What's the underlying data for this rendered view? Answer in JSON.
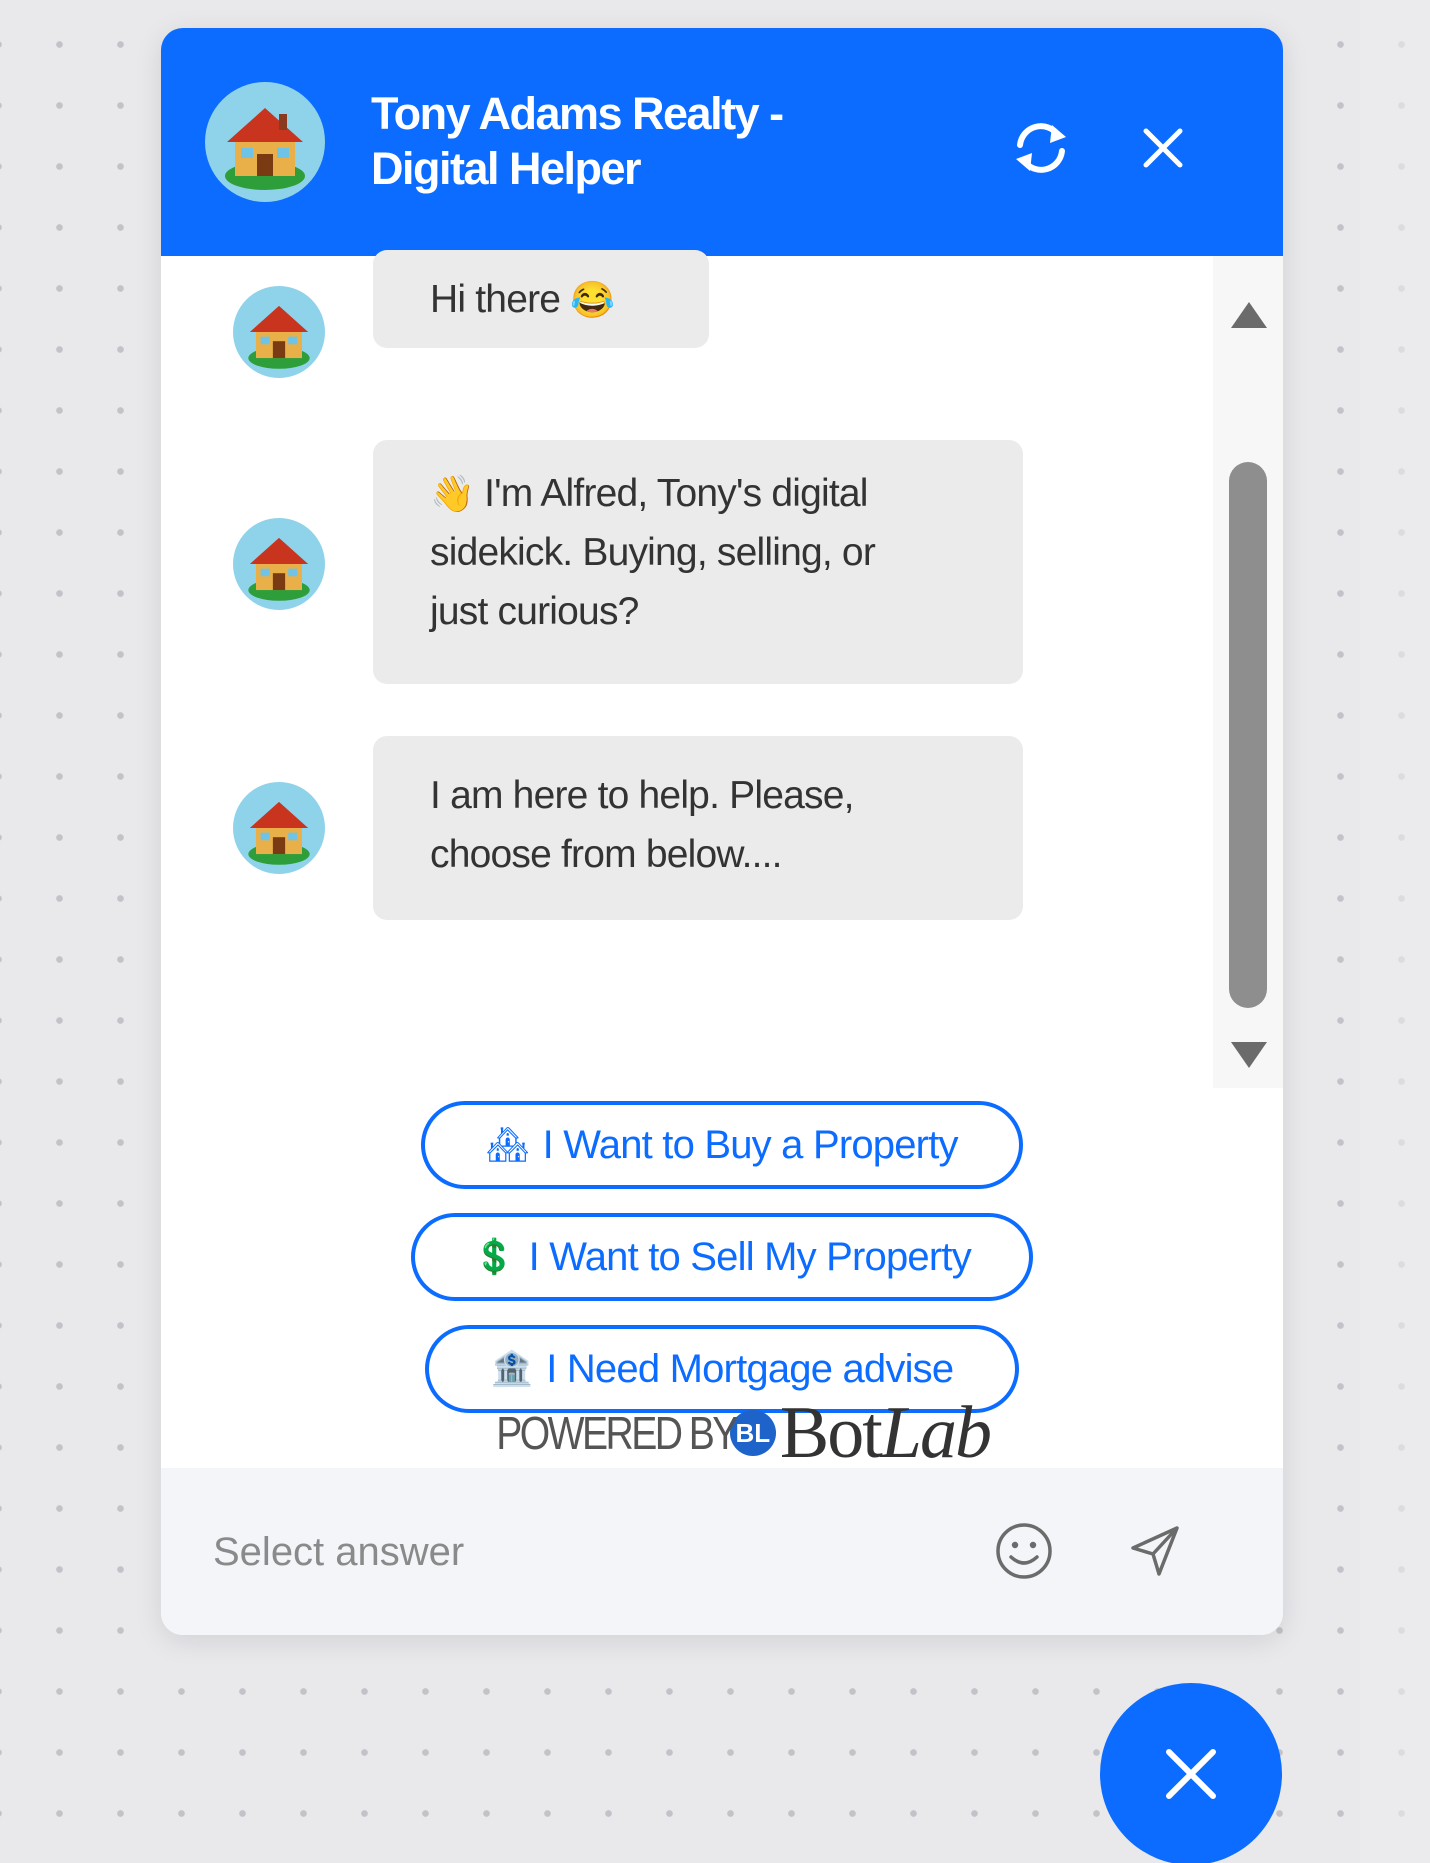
{
  "header": {
    "title_line1": "Tony Adams Realty -",
    "title_line2": "Digital Helper",
    "avatar_icon": "house-icon",
    "refresh_icon": "refresh-icon",
    "close_icon": "close-icon"
  },
  "messages": [
    {
      "text": "Hi there",
      "emoji": "😂"
    },
    {
      "emoji": "👋",
      "line1": "I'm Alfred, Tony's digital",
      "line2": "sidekick. Buying, selling, or",
      "line3": "just curious?"
    },
    {
      "line1": "I am here to help. Please,",
      "line2": "choose from below...."
    }
  ],
  "options": [
    {
      "icon": "🏘",
      "label": "I Want to Buy a Property"
    },
    {
      "icon": "💲",
      "label": "I Want to Sell My Property"
    },
    {
      "icon": "🏦",
      "label": "I Need Mortgage advise"
    }
  ],
  "powered_by": {
    "prefix": "POWERED BY",
    "logo_mark": "BL",
    "logo_part1": "Bot",
    "logo_part2": "Lab"
  },
  "composer": {
    "placeholder": "Select answer",
    "emoji_icon": "smiley-icon",
    "send_icon": "send-icon"
  },
  "launcher": {
    "icon": "close-icon"
  },
  "colors": {
    "brand": "#0b6cff",
    "bubble": "#ebebeb",
    "composer_bg": "#f3f5f8"
  }
}
